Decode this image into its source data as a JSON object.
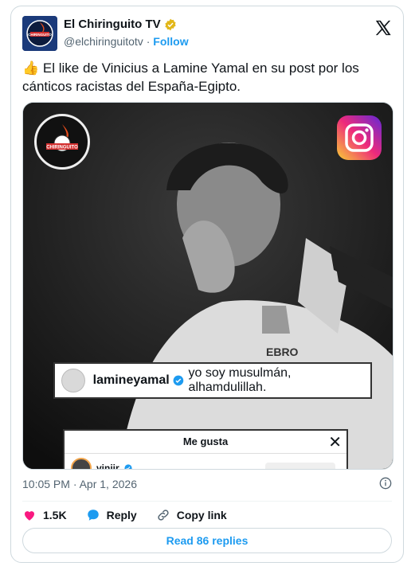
{
  "account": {
    "name": "El Chiringuito TV",
    "handle": "@elchiringuitotv",
    "separator": "·",
    "follow_label": "Follow",
    "avatar_text": "CHIRINGUITO"
  },
  "tweet": {
    "emoji": "👍",
    "text": "El like de Vinicius a Lamine Yamal en su post por los cánticos racistas del España-Egipto."
  },
  "media": {
    "logo_text": "CHIRINGUITO",
    "comment_user": "lamineyamal",
    "comment_text": "yo soy musulmán, alhamdulillah.",
    "likes_title": "Me gusta",
    "likes_close": "✕",
    "liker_user": "viniir"
  },
  "meta": {
    "timestamp": "10:05 PM · Apr 1, 2026"
  },
  "actions": {
    "likes_count": "1.5K",
    "reply_label": "Reply",
    "copy_link_label": "Copy link"
  },
  "replies": {
    "read_label": "Read 86 replies"
  },
  "colors": {
    "accent": "#1d9bf0",
    "like": "#f91880",
    "verified_gold": "#e2b719"
  }
}
